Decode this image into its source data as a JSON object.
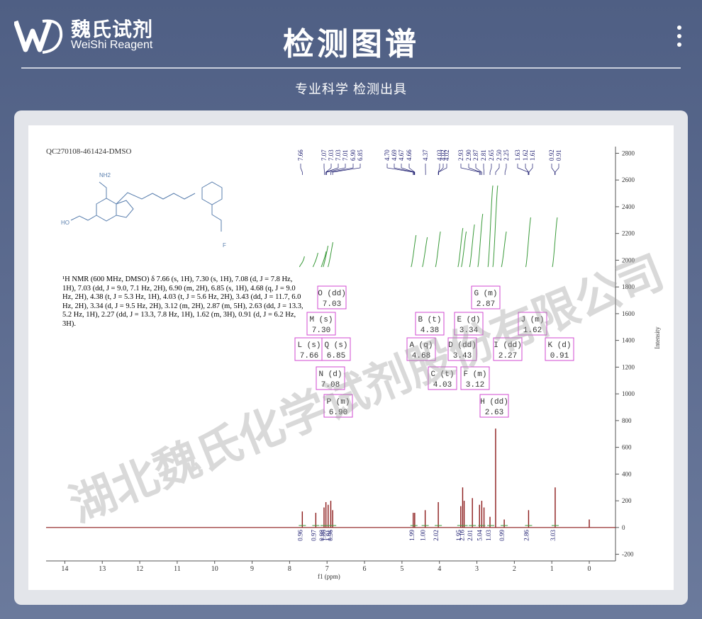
{
  "brand": {
    "name_cn": "魏氏试剂",
    "name_en": "WeiShi Reagent"
  },
  "header": {
    "title": "检测图谱",
    "subtitle": "专业科学  检测出具",
    "menu_icon": "more-vertical-icon"
  },
  "spectrum": {
    "sample_id": "QC270108-461424-DMSO",
    "nmr_text": "¹H NMR (600 MHz, DMSO) δ 7.66 (s, 1H), 7.30 (s, 1H), 7.08 (d, J = 7.8 Hz, 1H), 7.03 (dd, J = 9.0, 7.1 Hz, 2H), 6.90 (m, 2H), 6.85 (s, 1H), 4.68 (q, J = 9.0 Hz, 2H), 4.38 (t, J = 5.3 Hz, 1H), 4.03 (t, J = 5.6 Hz, 2H), 3.43 (dd, J = 11.7, 6.0 Hz, 2H), 3.34 (d, J = 9.5 Hz, 2H), 3.12 (m, 2H), 2.87 (m, 5H), 2.63 (dd, J = 13.3, 5.2 Hz, 1H), 2.27 (dd, J = 13.3, 7.8 Hz, 1H), 1.62 (m, 3H), 0.91 (d, J = 6.2 Hz, 3H).",
    "xlabel": "f1 (ppm)",
    "ylabel": "Intensity",
    "watermark": "湖北魏氏化学试剂股份有限公司",
    "peak_labels": [
      "7.66",
      "7.07",
      "7.03",
      "7.03",
      "7.01",
      "6.90",
      "6.85",
      "4.70",
      "4.69",
      "4.67",
      "4.66",
      "4.37",
      "4.03",
      "4.02",
      "4.02",
      "2.93",
      "2.90",
      "2.87",
      "2.81",
      "2.65",
      "2.50",
      "2.25",
      "1.63",
      "1.62",
      "1.61",
      "0.92",
      "0.91"
    ],
    "multiplets": [
      {
        "id": "O",
        "mult": "dd",
        "shift": "7.03"
      },
      {
        "id": "G",
        "mult": "m",
        "shift": "2.87"
      },
      {
        "id": "M",
        "mult": "s",
        "shift": "7.30"
      },
      {
        "id": "B",
        "mult": "t",
        "shift": "4.38"
      },
      {
        "id": "E",
        "mult": "d",
        "shift": "3.34"
      },
      {
        "id": "J",
        "mult": "m",
        "shift": "1.62"
      },
      {
        "id": "L",
        "mult": "s",
        "shift": "7.66"
      },
      {
        "id": "Q",
        "mult": "s",
        "shift": "6.85"
      },
      {
        "id": "A",
        "mult": "q",
        "shift": "4.68"
      },
      {
        "id": "D",
        "mult": "dd",
        "shift": "3.43"
      },
      {
        "id": "I",
        "mult": "dd",
        "shift": "2.27"
      },
      {
        "id": "K",
        "mult": "d",
        "shift": "0.91"
      },
      {
        "id": "N",
        "mult": "d",
        "shift": "7.08"
      },
      {
        "id": "C",
        "mult": "t",
        "shift": "4.03"
      },
      {
        "id": "F",
        "mult": "m",
        "shift": "3.12"
      },
      {
        "id": "P",
        "mult": "m",
        "shift": "6.90"
      },
      {
        "id": "H",
        "mult": "dd",
        "shift": "2.63"
      }
    ],
    "integrals": [
      {
        "x": 7.66,
        "v": "0.96"
      },
      {
        "x": 7.3,
        "v": "0.97"
      },
      {
        "x": 7.08,
        "v": "0.98"
      },
      {
        "x": 7.03,
        "v": "1.86"
      },
      {
        "x": 6.9,
        "v": "1.91"
      },
      {
        "x": 6.85,
        "v": "0.96"
      },
      {
        "x": 4.68,
        "v": "1.99"
      },
      {
        "x": 4.38,
        "v": "1.00"
      },
      {
        "x": 4.03,
        "v": "2.02"
      },
      {
        "x": 3.43,
        "v": "1.95"
      },
      {
        "x": 3.34,
        "v": "2.16"
      },
      {
        "x": 3.12,
        "v": "2.01"
      },
      {
        "x": 2.87,
        "v": "5.04"
      },
      {
        "x": 2.63,
        "v": "1.03"
      },
      {
        "x": 2.27,
        "v": "0.99"
      },
      {
        "x": 1.62,
        "v": "2.86"
      },
      {
        "x": 0.91,
        "v": "3.03"
      }
    ],
    "x_ticks": [
      "14",
      "13",
      "12",
      "11",
      "10",
      "9",
      "8",
      "7",
      "6",
      "5",
      "4",
      "3",
      "2",
      "1",
      "0"
    ],
    "y_ticks": [
      "2800",
      "2600",
      "2400",
      "2200",
      "2000",
      "1800",
      "1600",
      "1400",
      "1200",
      "1000",
      "800",
      "600",
      "400",
      "200",
      "0",
      "-200"
    ]
  },
  "chart_data": {
    "type": "line",
    "title": "QC270108-461424-DMSO",
    "xlabel": "f1 (ppm)",
    "ylabel": "Intensity",
    "xlim": [
      14.5,
      -0.7
    ],
    "ylim": [
      -250,
      2850
    ],
    "peaks": [
      {
        "x": 7.66,
        "y": 120
      },
      {
        "x": 7.3,
        "y": 110
      },
      {
        "x": 7.08,
        "y": 150
      },
      {
        "x": 7.03,
        "y": 190
      },
      {
        "x": 6.97,
        "y": 170
      },
      {
        "x": 6.9,
        "y": 200
      },
      {
        "x": 6.85,
        "y": 130
      },
      {
        "x": 4.7,
        "y": 110
      },
      {
        "x": 4.66,
        "y": 110
      },
      {
        "x": 4.38,
        "y": 130
      },
      {
        "x": 4.03,
        "y": 190
      },
      {
        "x": 3.43,
        "y": 160
      },
      {
        "x": 3.38,
        "y": 300
      },
      {
        "x": 3.34,
        "y": 200
      },
      {
        "x": 3.12,
        "y": 220
      },
      {
        "x": 2.93,
        "y": 170
      },
      {
        "x": 2.87,
        "y": 200
      },
      {
        "x": 2.81,
        "y": 150
      },
      {
        "x": 2.65,
        "y": 80
      },
      {
        "x": 2.5,
        "y": 740
      },
      {
        "x": 2.27,
        "y": 60
      },
      {
        "x": 1.62,
        "y": 130
      },
      {
        "x": 0.91,
        "y": 300
      },
      {
        "x": 0.0,
        "y": 60
      }
    ]
  }
}
